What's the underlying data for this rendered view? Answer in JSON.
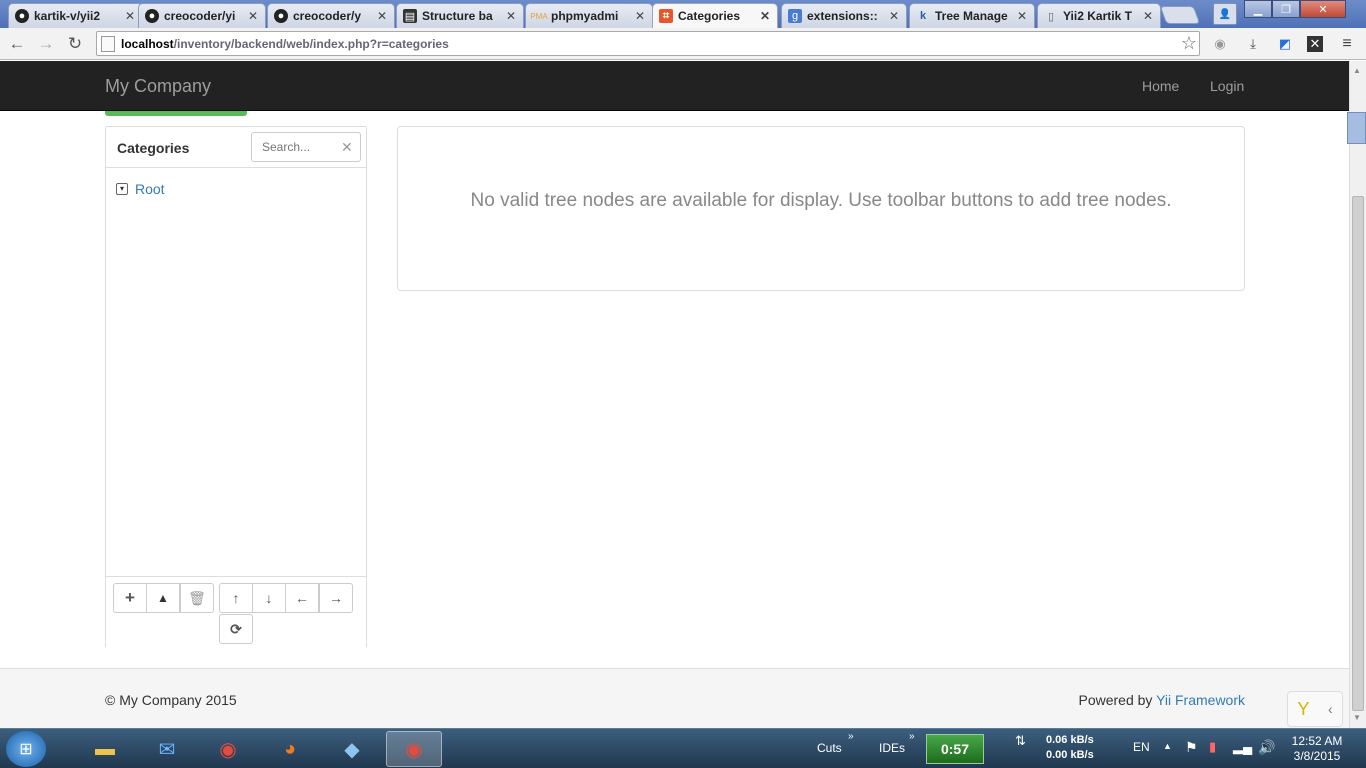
{
  "browser": {
    "tabs": [
      {
        "label": "kartik-v/yii2",
        "icon": "github-icon"
      },
      {
        "label": "creocoder/yi",
        "icon": "github-icon"
      },
      {
        "label": "creocoder/y",
        "icon": "github-icon"
      },
      {
        "label": "Structure ba",
        "icon": "document-icon"
      },
      {
        "label": "phpmyadmi",
        "icon": "phpmyadmin-icon"
      },
      {
        "label": "Categories",
        "icon": "yii-icon"
      },
      {
        "label": "extensions::",
        "icon": "google-icon"
      },
      {
        "label": "Tree Manage",
        "icon": "krajee-icon"
      },
      {
        "label": "Yii2 Kartik T",
        "icon": "page-icon"
      }
    ],
    "url_host": "localhost",
    "url_path": "/inventory/backend/web/index.php?r=categories"
  },
  "navbar": {
    "brand": "My Company",
    "links": [
      "Home",
      "Login"
    ]
  },
  "tree": {
    "title": "Categories",
    "search_placeholder": "Search...",
    "root_label": "Root",
    "toolbar": [
      "add-icon",
      "add-root-icon",
      "trash-icon",
      "arrow-up-icon",
      "arrow-down-icon",
      "arrow-left-icon",
      "arrow-right-icon",
      "refresh-icon"
    ]
  },
  "detail": {
    "message": "No valid tree nodes are available for display. Use toolbar buttons to add tree nodes."
  },
  "footer": {
    "copyright": "© My Company 2015",
    "powered_prefix": "Powered by ",
    "powered_link": "Yii Framework"
  },
  "taskbar": {
    "cuts": "Cuts",
    "ides": "IDEs",
    "timer": "0:57",
    "up_speed": "0.06 kB/s",
    "down_speed": "0.00 kB/s",
    "lang": "EN",
    "time": "12:52 AM",
    "date": "3/8/2015"
  },
  "colors": {
    "navbar_bg": "#222222",
    "link": "#337ab7",
    "success": "#5cb85c"
  }
}
